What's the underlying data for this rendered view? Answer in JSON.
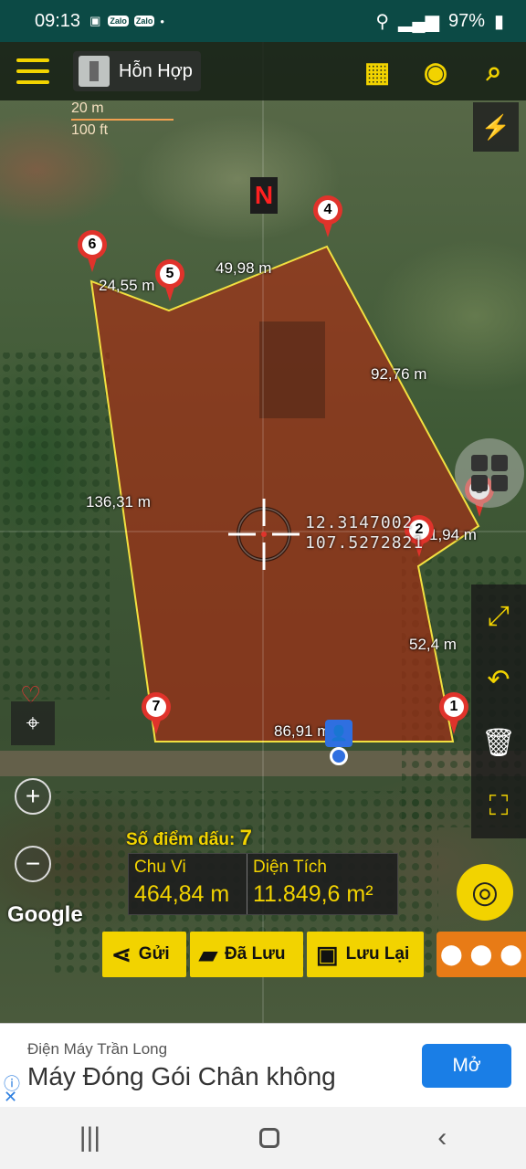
{
  "status_bar": {
    "time": "09:13",
    "battery": "97%"
  },
  "toolbar": {
    "map_type_label": "Hỗn Hợp"
  },
  "scale": {
    "meters": "20 m",
    "feet": "100 ft"
  },
  "compass": {
    "north_label": "N"
  },
  "points": [
    {
      "label": "1"
    },
    {
      "label": "2"
    },
    {
      "label": "3"
    },
    {
      "label": "4"
    },
    {
      "label": "5"
    },
    {
      "label": "6"
    },
    {
      "label": "7"
    }
  ],
  "edges": {
    "e1": "86,91 m",
    "e2": "52,4 m",
    "e3": "1,94 m",
    "e4": "92,76 m",
    "e5": "49,98 m",
    "e6": "24,55 m",
    "e7": "136,31 m"
  },
  "center": {
    "lat": "12.3147002",
    "lon": "107.5272821"
  },
  "stats": {
    "points_label": "Số điểm dấu:",
    "points_count": "7",
    "perimeter_label": "Chu Vi",
    "perimeter_value": "464,84 m",
    "area_label": "Diện Tích",
    "area_value": "11.849,6 m²"
  },
  "google_label": "Google",
  "actions": {
    "send": "Gửi",
    "saved": "Đã Lưu",
    "save": "Lưu Lại"
  },
  "ad": {
    "advertiser": "Điện Máy Trần Long",
    "headline": "Máy Đóng Gói Chân không",
    "cta": "Mở"
  },
  "colors": {
    "accent": "#f2d300",
    "polygon_fill": "#b02a12",
    "polygon_stroke": "#f2e040",
    "pin": "#e0332b",
    "status_bar": "#0c4a45"
  }
}
